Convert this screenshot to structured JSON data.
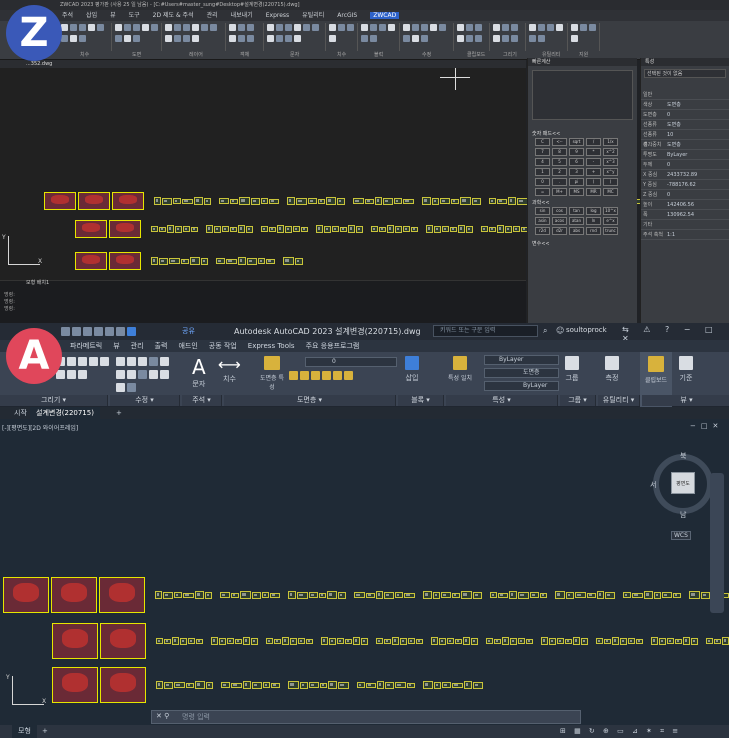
{
  "badges": {
    "top": "Z",
    "bottom": "A",
    "top_color": "#3a59b8",
    "bottom_color": "#e0475b"
  },
  "zwcad": {
    "title": "ZWCAD 2023 평가판 (사용 25 일 남음) - [C:#Users#master_sung#Desktop#설계변경(220715).dwg]",
    "menu": [
      "주석",
      "삽입",
      "뷰",
      "도구",
      "2D 제도 & 주석",
      "관리",
      "내보내기",
      "Express",
      "유틸리티",
      "ArcGIS",
      "ZWCAD"
    ],
    "active_menu": "ZWCAD",
    "ribbon_groups": [
      "치수",
      "도면",
      "레이어",
      "객체",
      "문자",
      "치수",
      "블럭",
      "수정",
      "클립보드",
      "그리기",
      "유틸리티",
      "지원"
    ],
    "doc_tab": "...352.dwg",
    "calc": {
      "title": "빠른계산",
      "numpad": "숫자 패드<<",
      "sci": "과학<<",
      "vars": "변수<<",
      "keys": [
        "C",
        "<--",
        "sqrt",
        "/",
        "1/x",
        "7",
        "8",
        "9",
        "*",
        "x^2",
        "4",
        "5",
        "6",
        "-",
        "x^3",
        "1",
        "2",
        "3",
        "+",
        "x^y",
        "0",
        ".",
        "pi",
        "(",
        ")",
        "=",
        "M+",
        "MS",
        "MR",
        "MC",
        "sin",
        "cos",
        "tan",
        "log",
        "10^x",
        "asin",
        "acos",
        "atan",
        "ln",
        "e^x",
        "r2d",
        "d2r",
        "abs",
        "rnd",
        "trunc"
      ]
    },
    "props": {
      "title": "특성",
      "selection": "선택된 것이 없음",
      "rows": [
        [
          "일반",
          ""
        ],
        [
          "색상",
          "도면층"
        ],
        [
          "도면층",
          "0"
        ],
        [
          "선종류",
          "도면층"
        ],
        [
          "선종류 축...",
          "10"
        ],
        [
          "선가중치",
          "도면층"
        ],
        [
          "투명도",
          "ByLayer"
        ],
        [
          "두께",
          "0"
        ],
        [
          "X 중심",
          "2433732.89"
        ],
        [
          "Y 중심",
          "-788176.62"
        ],
        [
          "Z 중심",
          "0"
        ],
        [
          "높이",
          "142406.56"
        ],
        [
          "폭",
          "130962.54"
        ],
        [
          "기타",
          ""
        ],
        [
          "주석 축척",
          "1:1"
        ]
      ]
    },
    "cmd_lines": [
      "명령:",
      "명령:",
      "명령:"
    ],
    "model_tabs": [
      "모형",
      "배치1"
    ]
  },
  "autocad": {
    "title": "Autodesk AutoCAD 2023   설계변경(220715).dwg",
    "search_placeholder": "키워드 또는 구문 입력",
    "user": "soultoprock",
    "share": "공유",
    "menu": [
      "파라메트릭",
      "뷰",
      "관리",
      "출력",
      "애드인",
      "공동 작업",
      "Express Tools",
      "주요 응용프로그램"
    ],
    "panels": [
      "그리기",
      "수정",
      "주석",
      "도면층",
      "블록",
      "특성",
      "그룹",
      "유틸리티",
      "뷰"
    ],
    "tools": {
      "text": "문자",
      "dim": "치수",
      "layer_props": "도면층 특성",
      "insert": "삽입",
      "match": "특성 일치",
      "group": "그룹",
      "measure": "측정",
      "clipboard": "클립보드",
      "base": "기준",
      "bylayer1": "ByLayer",
      "layer_line": "도면층",
      "bylayer2": "ByLayer",
      "layer_zero": "0"
    },
    "tabs": [
      "시작",
      "설계변경(220715)"
    ],
    "view_label": "[-][평면도][2D 와이어프레임]",
    "cube": {
      "top": "북",
      "left": "서",
      "right": "동",
      "bottom": "남",
      "face": "평면도",
      "wcs": "WCS"
    },
    "command_placeholder": "명령 입력",
    "status": [
      "모형"
    ]
  }
}
